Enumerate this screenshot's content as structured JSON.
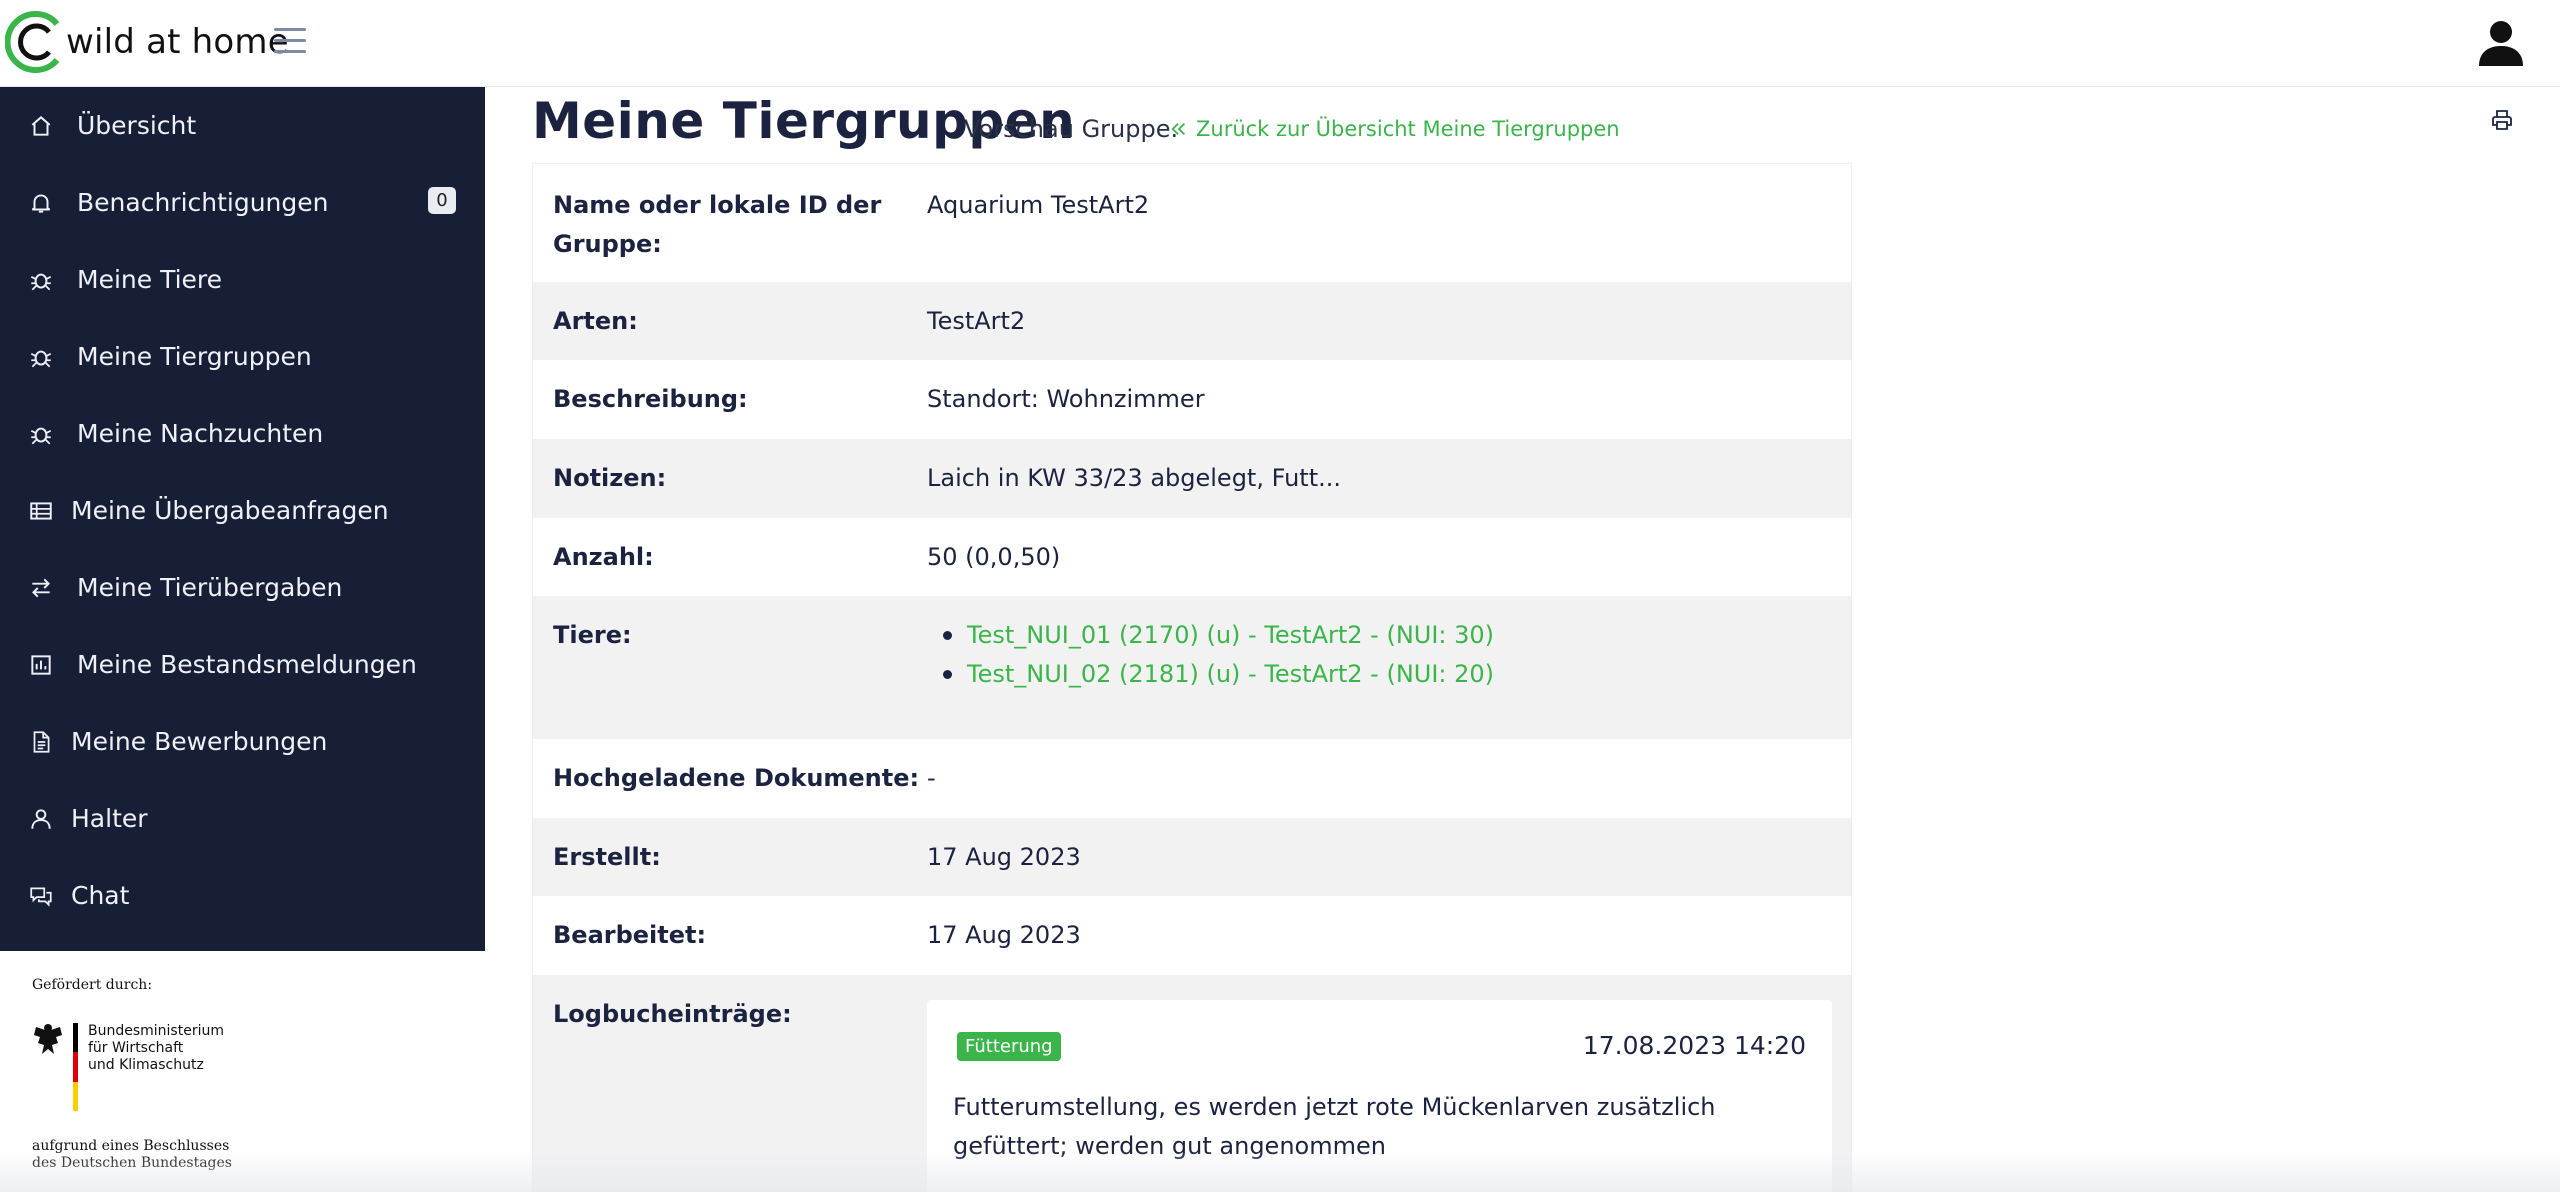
{
  "app": {
    "brand": "wild at home"
  },
  "colors": {
    "sidebar_bg": "#171f36",
    "accent": "#3bb54a",
    "title": "#1b2340"
  },
  "sidebar": {
    "items": [
      {
        "label": "Übersicht",
        "icon": "home-icon"
      },
      {
        "label": "Benachrichtigungen",
        "icon": "bell-icon",
        "badge": "0"
      },
      {
        "label": "Meine Tiere",
        "icon": "bug-icon"
      },
      {
        "label": "Meine Tiergruppen",
        "icon": "bug-icon"
      },
      {
        "label": "Meine Nachzuchten",
        "icon": "bug-icon"
      },
      {
        "label": "Meine Übergabeanfragen",
        "icon": "table-icon"
      },
      {
        "label": "Meine Tierübergaben",
        "icon": "transfer-icon"
      },
      {
        "label": "Meine Bestandsmeldungen",
        "icon": "chart-icon"
      },
      {
        "label": "Meine Bewerbungen",
        "icon": "document-icon"
      },
      {
        "label": "Halter",
        "icon": "user-icon"
      },
      {
        "label": "Chat",
        "icon": "chat-icon"
      }
    ]
  },
  "sponsor": {
    "funded_by": "Gefördert durch:",
    "ministry": "Bundesministerium\nfür Wirtschaft\nund Klimaschutz",
    "resolution": "aufgrund eines Beschlusses\ndes Deutschen Bundestages"
  },
  "main": {
    "title": "Meine Tiergruppen",
    "subtitle": "Vorschau Gruppe.",
    "back_link": "Zurück zur Übersicht Meine Tiergruppen",
    "rows": {
      "name_key": "Name oder lokale ID der Gruppe:",
      "name_value": "Aquarium TestArt2",
      "species_key": "Arten:",
      "species_value": "TestArt2",
      "description_key": "Beschreibung:",
      "description_value": "Standort: Wohnzimmer",
      "notes_key": "Notizen:",
      "notes_value": "Laich in KW 33/23 abgelegt, Futt...",
      "count_key": "Anzahl:",
      "count_value": "50 (0,0,50)",
      "animals_key": "Tiere:",
      "animals": [
        "Test_NUI_01 (2170) (u) - TestArt2 - (NUI: 30)",
        "Test_NUI_02 (2181) (u) - TestArt2 - (NUI: 20)"
      ],
      "documents_key": "Hochgeladene Dokumente:",
      "documents_value": "-",
      "created_key": "Erstellt:",
      "created_value": "17 Aug 2023",
      "edited_key": "Bearbeitet:",
      "edited_value": "17 Aug 2023",
      "log_key": "Logbucheinträge:"
    },
    "log_entry": {
      "category": "Fütterung",
      "datetime": "17.08.2023 14:20",
      "text": "Futterumstellung, es werden jetzt rote Mückenlarven zusätzlich gefüttert; werden gut angenommen"
    }
  }
}
